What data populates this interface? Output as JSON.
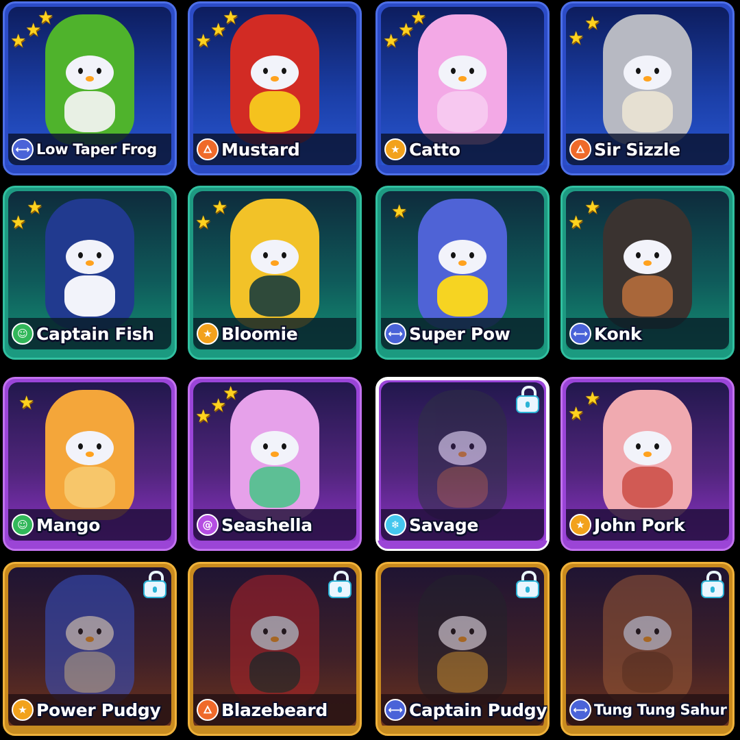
{
  "cards": [
    {
      "name": "Low Taper Frog",
      "cls": "dumbbell-icon",
      "cls_color": "#4a63d8",
      "stars": 3,
      "locked": false,
      "row": 0,
      "costume": "#4fb32c",
      "belly": "#e8f0e4"
    },
    {
      "name": "Mustard",
      "cls": "flame-icon",
      "cls_color": "#ef6a2a",
      "stars": 3,
      "locked": false,
      "row": 0,
      "costume": "#d22b24",
      "belly": "#f5c21e"
    },
    {
      "name": "Catto",
      "cls": "star-icon",
      "cls_color": "#f2a21c",
      "stars": 3,
      "locked": false,
      "row": 0,
      "costume": "#f3a9e6",
      "belly": "#f7c8f0"
    },
    {
      "name": "Sir Sizzle",
      "cls": "flame-icon",
      "cls_color": "#ef6a2a",
      "stars": 2,
      "locked": false,
      "row": 0,
      "costume": "#b7b9c2",
      "belly": "#e6e0d2"
    },
    {
      "name": "Captain Fish",
      "cls": "mask-icon",
      "cls_color": "#32b75a",
      "stars": 2,
      "locked": false,
      "row": 1,
      "costume": "#213a8f",
      "belly": "#f2f3fa"
    },
    {
      "name": "Bloomie",
      "cls": "star-icon",
      "cls_color": "#f2a21c",
      "stars": 2,
      "locked": false,
      "row": 1,
      "costume": "#f2c228",
      "belly": "#2f4a3a"
    },
    {
      "name": "Super Pow",
      "cls": "dumbbell-icon",
      "cls_color": "#4a63d8",
      "stars": 1,
      "locked": false,
      "row": 1,
      "costume": "#4f63d6",
      "belly": "#f6d422"
    },
    {
      "name": "Konk",
      "cls": "dumbbell-icon",
      "cls_color": "#4a63d8",
      "stars": 2,
      "locked": false,
      "row": 1,
      "costume": "#3a3330",
      "belly": "#a9673a"
    },
    {
      "name": "Mango",
      "cls": "mask-icon",
      "cls_color": "#32b75a",
      "stars": 1,
      "locked": false,
      "row": 2,
      "costume": "#f4a63a",
      "belly": "#f7c66a"
    },
    {
      "name": "Seashella",
      "cls": "spiral-icon",
      "cls_color": "#b54ee2",
      "stars": 3,
      "locked": false,
      "row": 2,
      "costume": "#e6a1ea",
      "belly": "#5dbf95"
    },
    {
      "name": "Savage",
      "cls": "snowflake-icon",
      "cls_color": "#45c7ee",
      "stars": 0,
      "locked": true,
      "row": 2,
      "costume": "#2e3142",
      "belly": "#8a5a32"
    },
    {
      "name": "John Pork",
      "cls": "star-icon",
      "cls_color": "#f2a21c",
      "stars": 2,
      "locked": false,
      "row": 2,
      "costume": "#f0aab0",
      "belly": "#d15a54"
    },
    {
      "name": "Power Pudgy",
      "cls": "star-icon",
      "cls_color": "#f2a21c",
      "stars": 0,
      "locked": true,
      "row": 3,
      "costume": "#3853c8",
      "belly": "#b8bcc8"
    },
    {
      "name": "Blazebeard",
      "cls": "flame-icon",
      "cls_color": "#ef6a2a",
      "stars": 0,
      "locked": true,
      "row": 3,
      "costume": "#b02328",
      "belly": "#2a2a2a"
    },
    {
      "name": "Captain Pudgy",
      "cls": "dumbbell-icon",
      "cls_color": "#4a63d8",
      "stars": 0,
      "locked": true,
      "row": 3,
      "costume": "#23232b",
      "belly": "#b58a32"
    },
    {
      "name": "Tung Tung Sahur",
      "cls": "dumbbell-icon",
      "cls_color": "#4a63d8",
      "stars": 0,
      "locked": true,
      "row": 3,
      "costume": "#9a5a36",
      "belly": "#7a4526"
    }
  ]
}
